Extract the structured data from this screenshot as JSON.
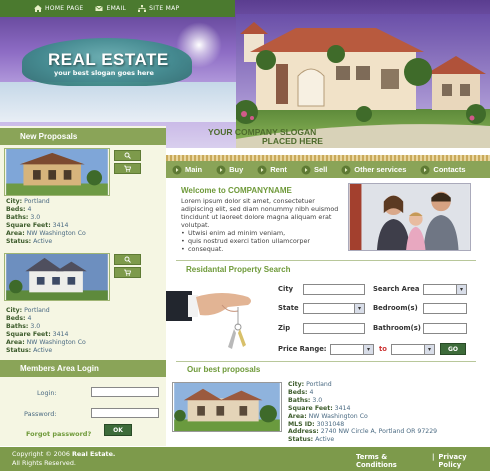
{
  "topnav": {
    "items": [
      {
        "label": "HOME PAGE",
        "icon": "home-icon"
      },
      {
        "label": "EMAIL",
        "icon": "email-icon"
      },
      {
        "label": "SITE MAP",
        "icon": "sitemap-icon"
      }
    ]
  },
  "logo": {
    "title": "REAL ESTATE",
    "subtitle": "your best slogan goes here"
  },
  "slogan": {
    "line1": "YOUR COMPANY SLOGAN",
    "line2": "PLACED HERE"
  },
  "left": {
    "new_proposals_title": "New Proposals",
    "proposals": [
      {
        "city_label": "City:",
        "city": "Portland",
        "beds_label": "Beds:",
        "beds": "4",
        "baths_label": "Baths:",
        "baths": "3.0",
        "sqft_label": "Square Feet:",
        "sqft": "3414",
        "area_label": "Area:",
        "area": "NW Washington Co",
        "status_label": "Status:",
        "status": "Active"
      },
      {
        "city_label": "City:",
        "city": "Portland",
        "beds_label": "Beds:",
        "beds": "4",
        "baths_label": "Baths:",
        "baths": "3.0",
        "sqft_label": "Square Feet:",
        "sqft": "3414",
        "area_label": "Area:",
        "area": "NW Washington Co",
        "status_label": "Status:",
        "status": "Active"
      }
    ],
    "members_title": "Members Area Login",
    "login_label": "Login:",
    "password_label": "Password:",
    "forgot": "Forgot password?",
    "ok": "OK"
  },
  "mainnav": [
    "Main",
    "Buy",
    "Rent",
    "Sell",
    "Other services",
    "Contacts"
  ],
  "welcome": {
    "title": "Welcome to COMPANYNAME",
    "para": "Lorem ipsum dolor sit amet, consectetuer adipiscing elit, sed diam nonummy nibh euismod tincidunt ut laoreet dolore magna aliquam erat volutpat.",
    "bullets": [
      "Utwisi enim ad minim veniam,",
      "quis nostrud exerci tation ullamcorper",
      "consequat."
    ]
  },
  "search": {
    "title": "Residantal Property Search",
    "city": "City",
    "search_area": "Search Area",
    "state": "State",
    "bedrooms": "Bedroom(s)",
    "zip": "Zip",
    "bathrooms": "Bathroom(s)",
    "price_range": "Price Range:",
    "to": "to",
    "go": "GO"
  },
  "best": {
    "title": "Our best proposals",
    "city_label": "City:",
    "city": "Portland",
    "beds_label": "Beds:",
    "beds": "4",
    "baths_label": "Baths:",
    "baths": "3.0",
    "sqft_label": "Square Feet:",
    "sqft": "3414",
    "area_label": "Area:",
    "area": "NW Washington Co",
    "mls_label": "MLS ID:",
    "mls": "3031048",
    "address_label": "Address:",
    "address": "2740 NW Circle A, Portland OR 97229",
    "status_label": "Status:",
    "status": "Active"
  },
  "footer": {
    "copyright_prefix": "Copyright © 2006",
    "brand": "Real Estate.",
    "rights": "All Rights Reserved.",
    "terms": "Terms & Conditions",
    "divider": "|",
    "privacy": "Privacy Policy"
  },
  "colors": {
    "green": "#8aa458",
    "darkgreen": "#3d6b3a",
    "link": "#6f9a3a"
  }
}
